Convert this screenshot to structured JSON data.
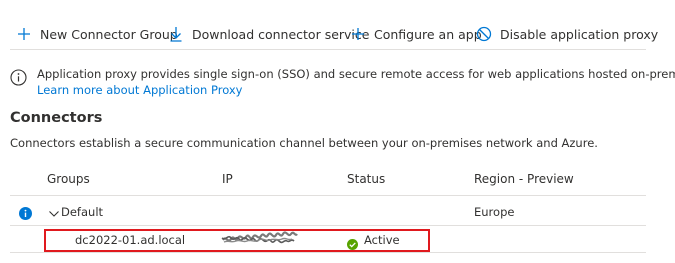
{
  "toolbar": {
    "new_group": "New Connector Group",
    "download": "Download connector service",
    "configure": "Configure an app",
    "disable": "Disable application proxy"
  },
  "info": {
    "text": "Application proxy provides single sign-on (SSO) and secure remote access for web applications hosted on-premises.",
    "link": "Learn more about Application Proxy"
  },
  "section": {
    "title": "Connectors",
    "description": "Connectors establish a secure communication channel between your on-premises network and Azure."
  },
  "table": {
    "columns": [
      "Groups",
      "IP",
      "Status",
      "Region - Preview"
    ],
    "group": {
      "name": "Default",
      "region": "Europe"
    },
    "connector": {
      "name": "dc2022-01.ad.local",
      "ip": "",
      "status": "Active"
    }
  },
  "colors": {
    "accent": "#0078d4",
    "active": "#57a300",
    "highlight": "#e0191e"
  }
}
